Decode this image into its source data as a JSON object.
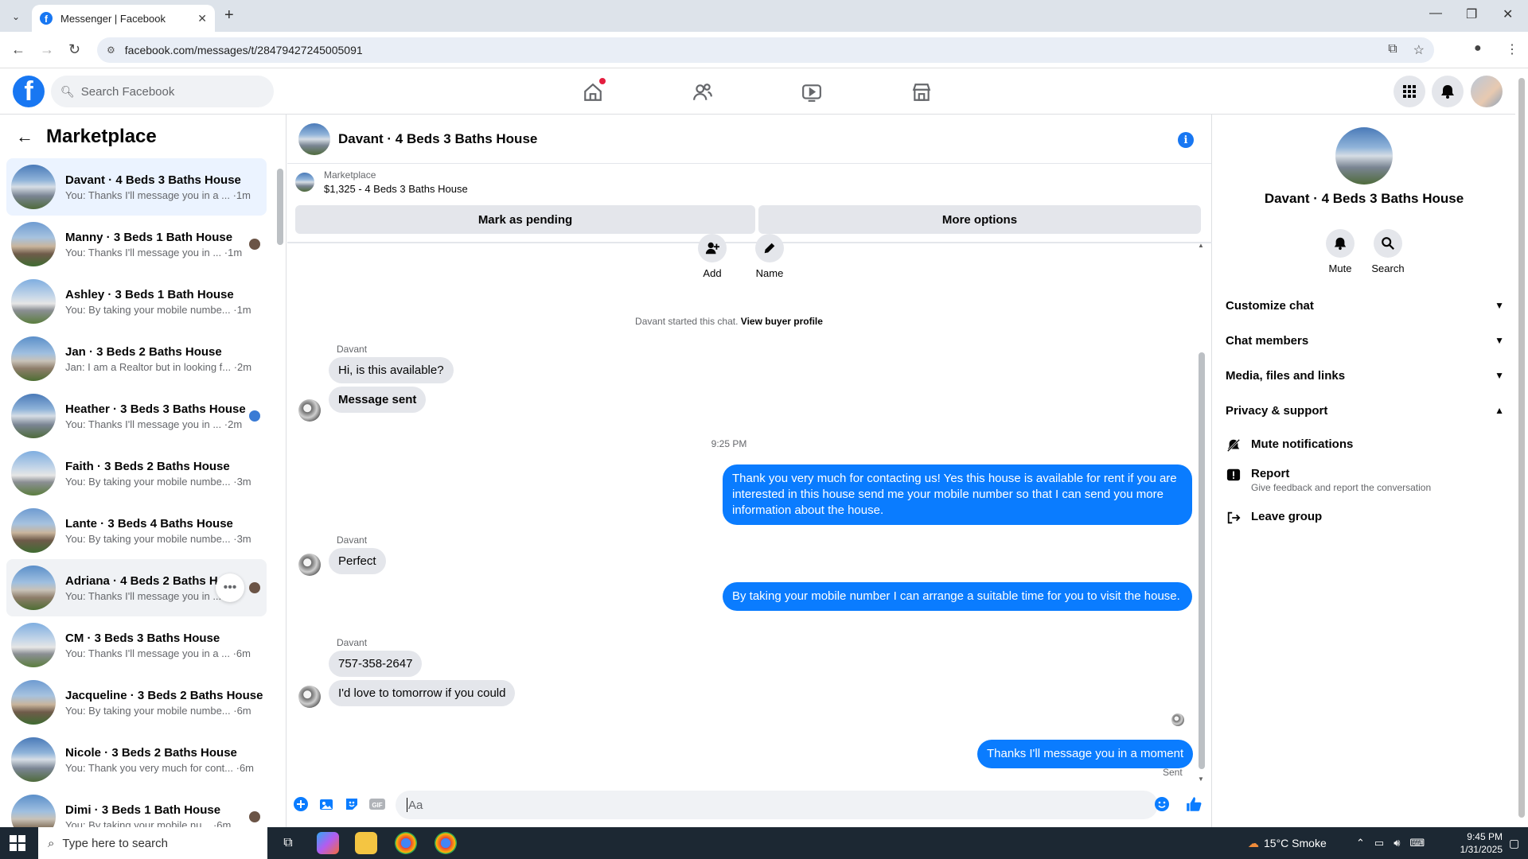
{
  "browser": {
    "tab_title": "Messenger | Facebook",
    "url": "facebook.com/messages/t/28479427245005091"
  },
  "header": {
    "search_placeholder": "Search Facebook"
  },
  "sidebar": {
    "title": "Marketplace",
    "conversations": [
      {
        "name": "Davant · 4 Beds 3 Baths House",
        "preview": "You: Thanks I'll message you in a ... ·1m",
        "state": "active"
      },
      {
        "name": "Manny · 3 Beds 1 Bath House",
        "preview": "You: Thanks I'll message you in ... ·1m"
      },
      {
        "name": "Ashley · 3 Beds 1 Bath House",
        "preview": "You: By taking your mobile numbe... ·1m"
      },
      {
        "name": "Jan · 3 Beds 2 Baths House",
        "preview": "Jan: I am a Realtor but in looking f... ·2m"
      },
      {
        "name": "Heather · 3 Beds 3 Baths House",
        "preview": "You: Thanks I'll message you in ... ·2m"
      },
      {
        "name": "Faith · 3 Beds 2 Baths House",
        "preview": "You: By taking your mobile numbe... ·3m"
      },
      {
        "name": "Lante · 3 Beds 4 Baths House",
        "preview": "You: By taking your mobile numbe... ·3m"
      },
      {
        "name": "Adriana · 4 Beds 2 Baths Ho",
        "preview": "You: Thanks I'll message you in ...",
        "state": "hover"
      },
      {
        "name": "CM · 3 Beds 3 Baths House",
        "preview": "You: Thanks I'll message you in a ... ·6m"
      },
      {
        "name": "Jacqueline · 3 Beds 2 Baths House",
        "preview": "You: By taking your mobile numbe... ·6m"
      },
      {
        "name": "Nicole · 3 Beds 2 Baths House",
        "preview": "You: Thank you very much for cont... ·6m"
      },
      {
        "name": "Dimi · 3 Beds 1 Bath House",
        "preview": "You: By taking your mobile nu... ·6m"
      }
    ]
  },
  "chat": {
    "title": "Davant · 4 Beds 3 Baths House",
    "listing_label": "Marketplace",
    "listing_detail": "$1,325 - 4 Beds 3 Baths House",
    "mark_pending": "Mark as pending",
    "more_options": "More options",
    "add_label": "Add",
    "name_label": "Name",
    "system_msg": "Davant started this chat.",
    "view_profile": "View buyer profile",
    "sender": "Davant",
    "msg1": "Hi, is this available?",
    "msg2": "Message sent",
    "timestamp": "9:25 PM",
    "out1": "Thank you very much for contacting us! Yes this house is available for rent if you are interested in this house send me your mobile number so that I can send you more information about the house.",
    "msg3": "Perfect",
    "out2": "By taking your mobile number I can arrange a suitable time for you to visit the house.",
    "msg4": "757-358-2647",
    "msg5": "I'd love to tomorrow if you could",
    "out3": "Thanks I'll message you in a moment",
    "sent_status": "Sent",
    "composer_placeholder": "Aa"
  },
  "right_panel": {
    "title": "Davant · 4 Beds 3 Baths House",
    "mute": "Mute",
    "search": "Search",
    "customize": "Customize chat",
    "members": "Chat members",
    "media": "Media, files and links",
    "privacy": "Privacy & support",
    "mute_notifications": "Mute notifications",
    "report": "Report",
    "report_sub": "Give feedback and report the conversation",
    "leave": "Leave group"
  },
  "taskbar": {
    "search_placeholder": "Type here to search",
    "weather": "15°C  Smoke",
    "time": "9:45 PM",
    "date": "1/31/2025"
  },
  "colors": {
    "accent": "#1877f2",
    "outgoing_bubble": "#0a7cff"
  }
}
